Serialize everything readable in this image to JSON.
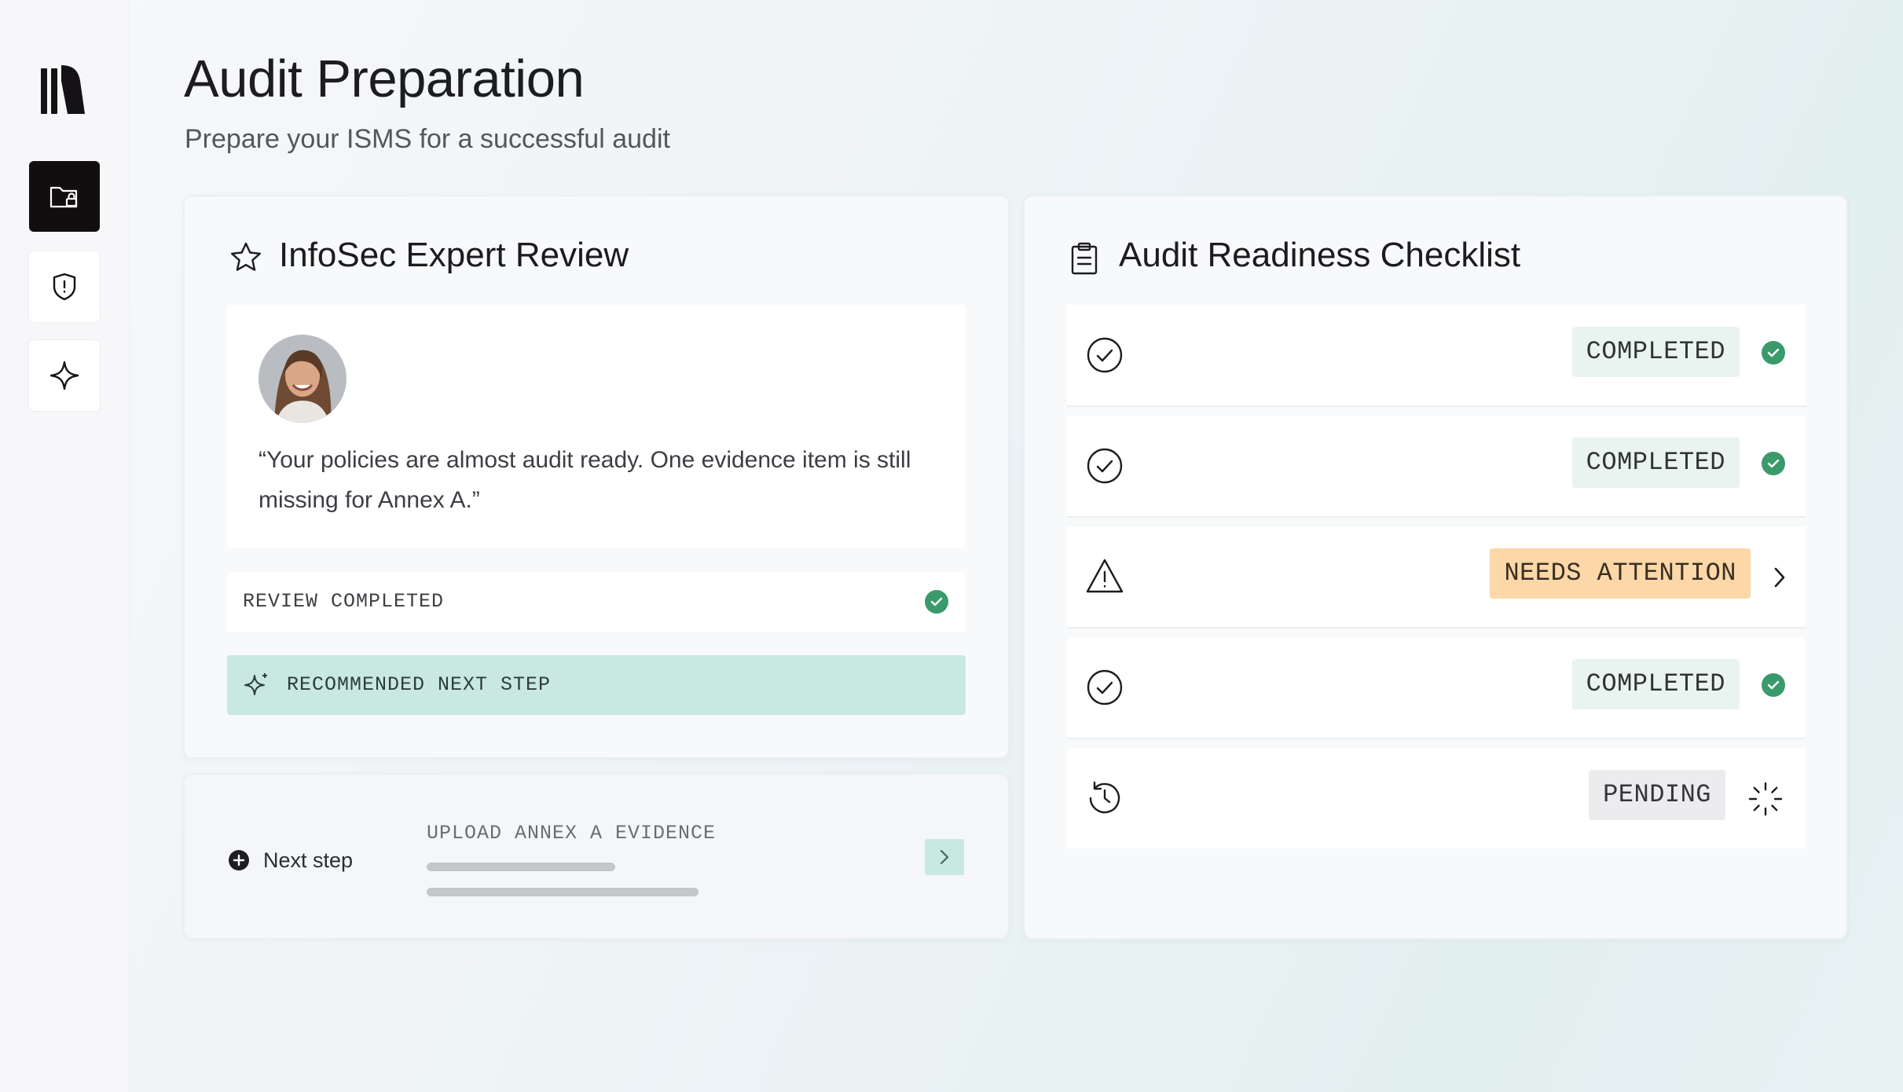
{
  "sidebar": {
    "logo_icon": "library-icon",
    "items": [
      {
        "icon": "folder-lock-icon",
        "active": true
      },
      {
        "icon": "shield-alert-icon",
        "active": false
      },
      {
        "icon": "sparkle-icon",
        "active": false
      }
    ]
  },
  "header": {
    "title": "Audit Preparation",
    "subtitle": "Prepare your ISMS for a successful audit"
  },
  "expert_review": {
    "icon": "star-icon",
    "title": "InfoSec Expert Review",
    "quote": "“Your policies are almost audit ready. One evidence item is still missing for Annex A.”",
    "status_label": "REVIEW COMPLETED",
    "next_label": "RECOMMENDED NEXT STEP"
  },
  "next_step": {
    "label": "Next step",
    "action": "UPLOAD ANNEX A EVIDENCE"
  },
  "checklist": {
    "icon": "clipboard-icon",
    "title": "Audit Readiness Checklist",
    "items": [
      {
        "status": "COMPLETED",
        "icon": "check-circle-icon"
      },
      {
        "status": "COMPLETED",
        "icon": "check-circle-icon"
      },
      {
        "status": "NEEDS ATTENTION",
        "icon": "warning-triangle-icon"
      },
      {
        "status": "COMPLETED",
        "icon": "check-circle-icon"
      },
      {
        "status": "PENDING",
        "icon": "clock-rotate-icon"
      }
    ]
  },
  "colors": {
    "accent_green": "#3a9a6c",
    "mint": "#c9e8e0",
    "attention": "#fcd7a8",
    "sidebar_active": "#120e0f"
  }
}
